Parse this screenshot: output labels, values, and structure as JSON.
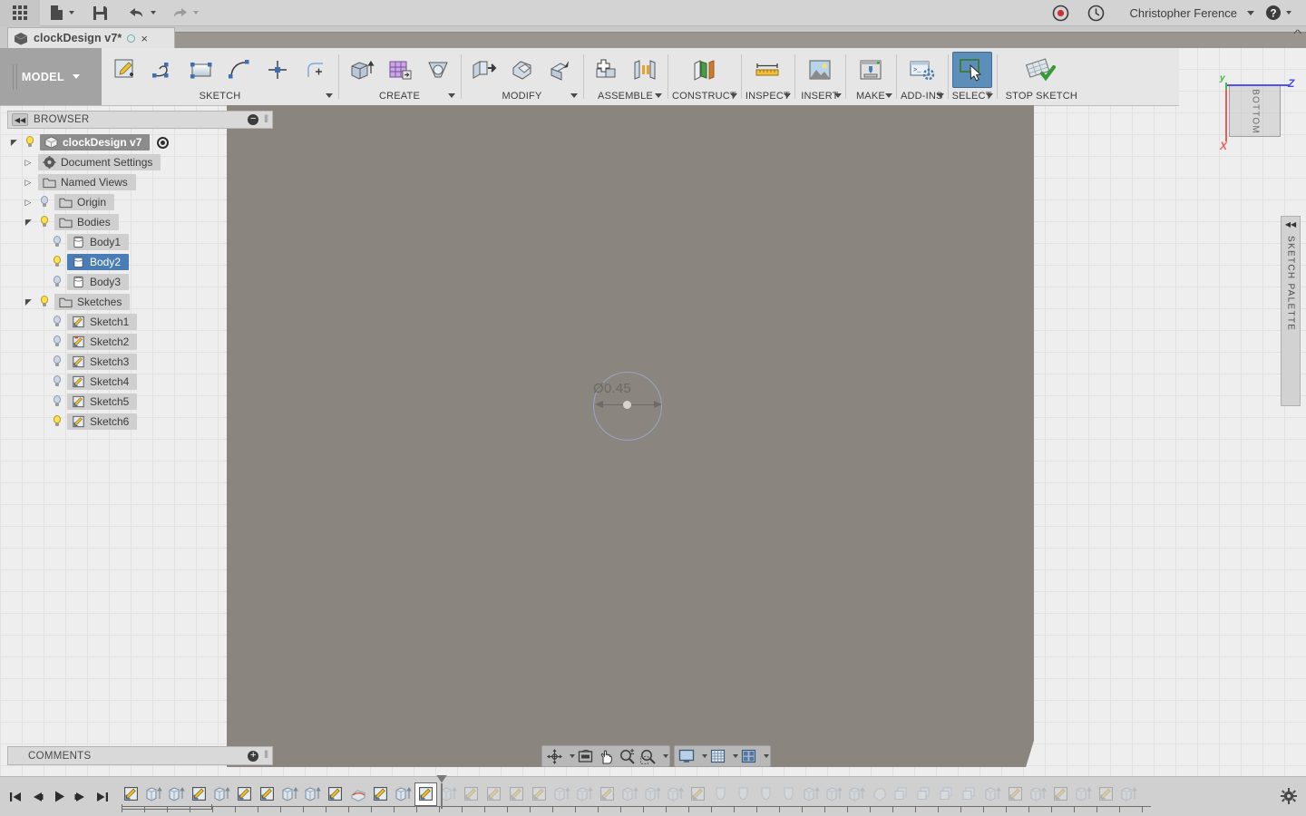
{
  "topbar": {
    "apps_icon": "waffle-grid-icon",
    "new_label": "new-file-icon",
    "save_label": "save-icon",
    "undo_label": "undo-icon",
    "redo_label": "redo-icon",
    "record_icon": "record-icon",
    "history_icon": "clock-icon",
    "username": "Christopher Ference",
    "help_icon": "help-icon"
  },
  "tab": {
    "title": "clockDesign v7*",
    "close": "×"
  },
  "ribbon": {
    "workspace": "MODEL",
    "panels": [
      {
        "name": "SKETCH",
        "label": "SKETCH"
      },
      {
        "name": "CREATE",
        "label": "CREATE"
      },
      {
        "name": "MODIFY",
        "label": "MODIFY"
      },
      {
        "name": "ASSEMBLE",
        "label": "ASSEMBLE"
      },
      {
        "name": "CONSTRUCT",
        "label": "CONSTRUCT"
      },
      {
        "name": "INSPECT",
        "label": "INSPECT"
      },
      {
        "name": "INSERT",
        "label": "INSERT"
      },
      {
        "name": "MAKE",
        "label": "MAKE"
      },
      {
        "name": "ADDINS",
        "label": "ADD-INS"
      },
      {
        "name": "SELECT",
        "label": "SELECT"
      },
      {
        "name": "STOPSKETCH",
        "label": "STOP SKETCH"
      }
    ],
    "select_active": true
  },
  "browser": {
    "header": "BROWSER",
    "collapse_icon": "double-chevron-left-icon",
    "minimize_icon": "minus-icon",
    "root": {
      "label": "clockDesign v7",
      "visible": true,
      "expanded": true,
      "selected": true
    },
    "nodes": [
      {
        "label": "Document Settings",
        "icon": "gear-icon",
        "expanded": false,
        "bulb": null,
        "indent": 1
      },
      {
        "label": "Named Views",
        "icon": "folder-icon",
        "expanded": false,
        "bulb": null,
        "indent": 1
      },
      {
        "label": "Origin",
        "icon": "folder-icon",
        "expanded": false,
        "bulb": "off",
        "indent": 1
      },
      {
        "label": "Bodies",
        "icon": "folder-icon",
        "expanded": true,
        "bulb": "on",
        "indent": 1
      },
      {
        "label": "Body1",
        "icon": "body-icon",
        "expanded": null,
        "bulb": "off",
        "indent": 3
      },
      {
        "label": "Body2",
        "icon": "body-icon",
        "expanded": null,
        "bulb": "on",
        "indent": 3,
        "selected": true
      },
      {
        "label": "Body3",
        "icon": "body-icon",
        "expanded": null,
        "bulb": "off",
        "indent": 3
      },
      {
        "label": "Sketches",
        "icon": "folder-icon",
        "expanded": true,
        "bulb": "on",
        "indent": 1
      },
      {
        "label": "Sketch1",
        "icon": "sketch-icon",
        "expanded": null,
        "bulb": "off",
        "indent": 3
      },
      {
        "label": "Sketch2",
        "icon": "sketch-warn-icon",
        "expanded": null,
        "bulb": "off",
        "indent": 3
      },
      {
        "label": "Sketch3",
        "icon": "sketch-icon",
        "expanded": null,
        "bulb": "off",
        "indent": 3
      },
      {
        "label": "Sketch4",
        "icon": "sketch-icon",
        "expanded": null,
        "bulb": "off",
        "indent": 3
      },
      {
        "label": "Sketch5",
        "icon": "sketch-icon",
        "expanded": null,
        "bulb": "off",
        "indent": 3
      },
      {
        "label": "Sketch6",
        "icon": "sketch-icon",
        "expanded": null,
        "bulb": "on",
        "indent": 3
      }
    ]
  },
  "comments": {
    "header": "COMMENTS",
    "add_icon": "plus-icon"
  },
  "canvas": {
    "dimension_label": "Ø0.45",
    "background_color": "#8a857e",
    "sketch_color": "#9aa4c4"
  },
  "viewcube": {
    "face_label": "BOTTOM",
    "axis_x": "X",
    "axis_y": "y",
    "axis_z": "Z",
    "color_x": "#f05a5a",
    "color_y": "#3cb53c",
    "color_z": "#4a4aef"
  },
  "palette": {
    "label": "SKETCH PALETTE",
    "collapse_icon": "double-chevron-left-icon"
  },
  "navbar": {
    "buttons": [
      "orbit-icon",
      "look-at-icon",
      "pan-icon",
      "zoom-icon",
      "fit-icon"
    ],
    "display_buttons": [
      "display-settings-icon",
      "grid-snap-icon",
      "viewports-icon"
    ]
  },
  "timeline": {
    "playback": [
      "skip-start-icon",
      "step-back-icon",
      "play-icon",
      "step-forward-icon",
      "skip-end-icon"
    ],
    "playhead_index": 13,
    "settings_icon": "gear-icon",
    "features": [
      {
        "type": "sketch"
      },
      {
        "type": "extrude"
      },
      {
        "type": "extrude"
      },
      {
        "type": "sketch"
      },
      {
        "type": "extrude"
      },
      {
        "type": "sketch"
      },
      {
        "type": "sketch"
      },
      {
        "type": "extrude"
      },
      {
        "type": "extrude"
      },
      {
        "type": "sketch"
      },
      {
        "type": "fillet"
      },
      {
        "type": "sketch"
      },
      {
        "type": "extrude"
      },
      {
        "type": "sketch"
      },
      {
        "type": "extrude"
      },
      {
        "type": "sketch"
      },
      {
        "type": "sketch"
      },
      {
        "type": "sketch"
      },
      {
        "type": "sketch"
      },
      {
        "type": "extrude"
      },
      {
        "type": "extrude"
      },
      {
        "type": "sketch"
      },
      {
        "type": "extrude"
      },
      {
        "type": "extrude"
      },
      {
        "type": "extrude"
      },
      {
        "type": "sketch"
      },
      {
        "type": "revolve"
      },
      {
        "type": "revolve"
      },
      {
        "type": "revolve"
      },
      {
        "type": "revolve"
      },
      {
        "type": "extrude"
      },
      {
        "type": "extrude"
      },
      {
        "type": "extrude"
      },
      {
        "type": "chamfer"
      },
      {
        "type": "pattern"
      },
      {
        "type": "pattern"
      },
      {
        "type": "pattern"
      },
      {
        "type": "pattern"
      },
      {
        "type": "extrude"
      },
      {
        "type": "sketch"
      },
      {
        "type": "extrude"
      },
      {
        "type": "sketch"
      },
      {
        "type": "extrude"
      },
      {
        "type": "sketch"
      },
      {
        "type": "extrude"
      }
    ]
  }
}
